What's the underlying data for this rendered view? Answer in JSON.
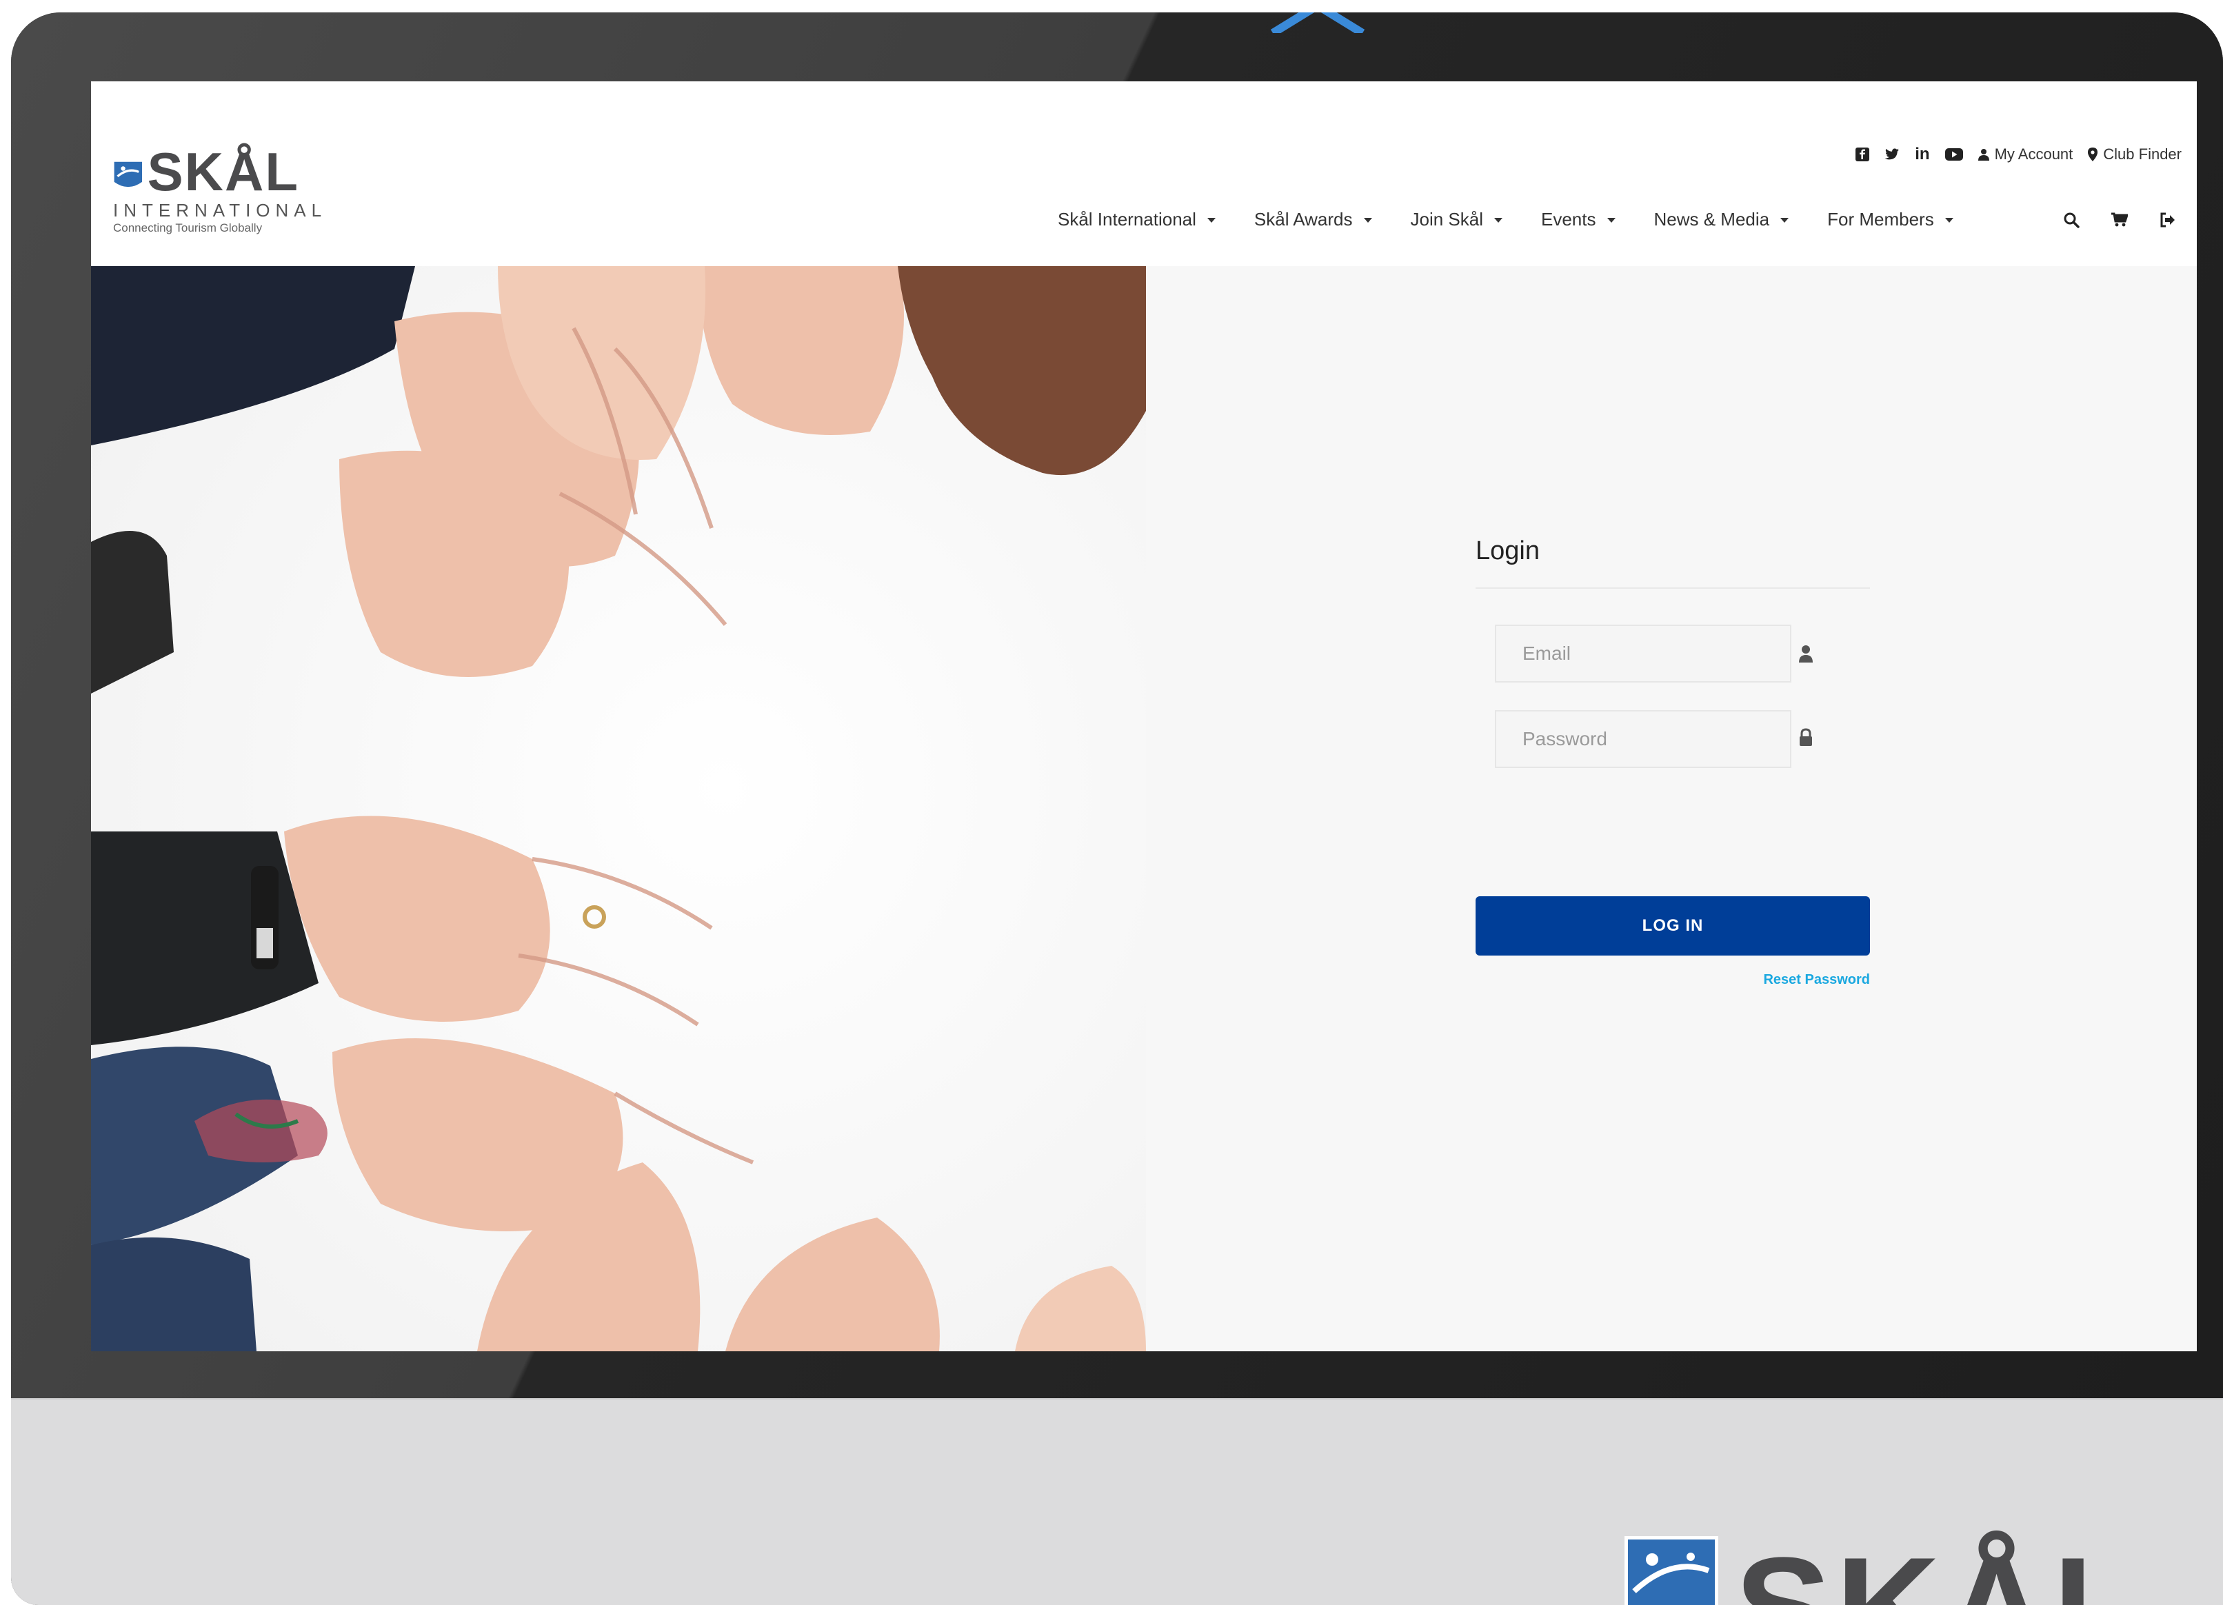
{
  "header": {
    "logo": {
      "wordmark": "SKÅL",
      "subtitle": "INTERNATIONAL",
      "tagline": "Connecting Tourism Globally"
    },
    "utility": {
      "social_icons": [
        "facebook-icon",
        "twitter-icon",
        "linkedin-icon",
        "youtube-icon"
      ],
      "linkedin_text": "in",
      "my_account": "My Account",
      "club_finder": "Club Finder"
    },
    "nav": [
      {
        "label": "Skål International"
      },
      {
        "label": "Skål Awards"
      },
      {
        "label": "Join Skål"
      },
      {
        "label": "Events"
      },
      {
        "label": "News & Media"
      },
      {
        "label": "For Members"
      }
    ],
    "tools": [
      "search-icon",
      "cart-icon",
      "logout-icon"
    ]
  },
  "login": {
    "title": "Login",
    "email_placeholder": "Email",
    "password_placeholder": "Password",
    "submit_label": "LOG IN",
    "reset_label": "Reset Password"
  },
  "device": {
    "chin_wordmark": "SKÅL"
  },
  "colors": {
    "primary_button": "#003e98",
    "reset_link": "#1aa8e0",
    "bezel": "#1f1f1f",
    "chin": "#dcdcdd",
    "logo_blue": "#2e6db4"
  }
}
